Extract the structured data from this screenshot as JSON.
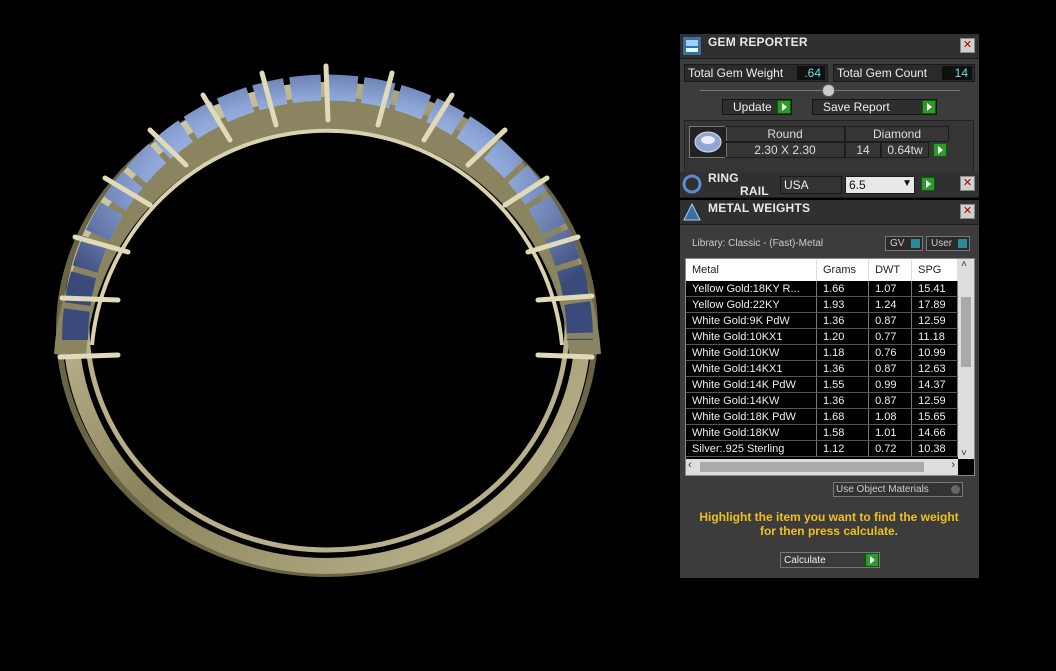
{
  "gem_reporter": {
    "title": "GEM REPORTER",
    "total_gem_weight_label": "Total Gem Weight",
    "total_gem_weight_value": ".64",
    "total_gem_count_label": "Total Gem Count",
    "total_gem_count_value": "14",
    "update_label": "Update",
    "save_report_label": "Save Report",
    "gem_row": {
      "shape": "Round",
      "size": "2.30 X 2.30",
      "material": "Diamond",
      "count": "14",
      "weight": "0.64tw"
    }
  },
  "ring_rail": {
    "title_line1": "RING",
    "title_line2": "RAIL",
    "region": "USA",
    "size": "6.5"
  },
  "metal_weights": {
    "title": "METAL WEIGHTS",
    "library": "Library: Classic - (Fast)-Metal",
    "gv_label": "GV",
    "user_label": "User",
    "columns": [
      "Metal",
      "Grams",
      "DWT",
      "SPG"
    ],
    "rows": [
      [
        "Yellow Gold:18KY R...",
        "1.66",
        "1.07",
        "15.41"
      ],
      [
        "Yellow Gold:22KY",
        "1.93",
        "1.24",
        "17.89"
      ],
      [
        "White Gold:9K PdW",
        "1.36",
        "0.87",
        "12.59"
      ],
      [
        "White Gold:10KX1",
        "1.20",
        "0.77",
        "11.18"
      ],
      [
        "White Gold:10KW",
        "1.18",
        "0.76",
        "10.99"
      ],
      [
        "White Gold:14KX1",
        "1.36",
        "0.87",
        "12.63"
      ],
      [
        "White Gold:14K PdW",
        "1.55",
        "0.99",
        "14.37"
      ],
      [
        "White Gold:14KW",
        "1.36",
        "0.87",
        "12.59"
      ],
      [
        "White Gold:18K PdW",
        "1.68",
        "1.08",
        "15.65"
      ],
      [
        "White Gold:18KW",
        "1.58",
        "1.01",
        "14.66"
      ],
      [
        "Silver:.925 Sterling",
        "1.12",
        "0.72",
        "10.38"
      ]
    ],
    "use_object_materials": "Use Object Materials",
    "hint": "Highlight the item you want to find the weight for then press calculate.",
    "calculate_label": "Calculate"
  },
  "colors": {
    "hint": "#f0c020",
    "value_text": "#6fdede",
    "accent_green": "#2e9a2e"
  }
}
